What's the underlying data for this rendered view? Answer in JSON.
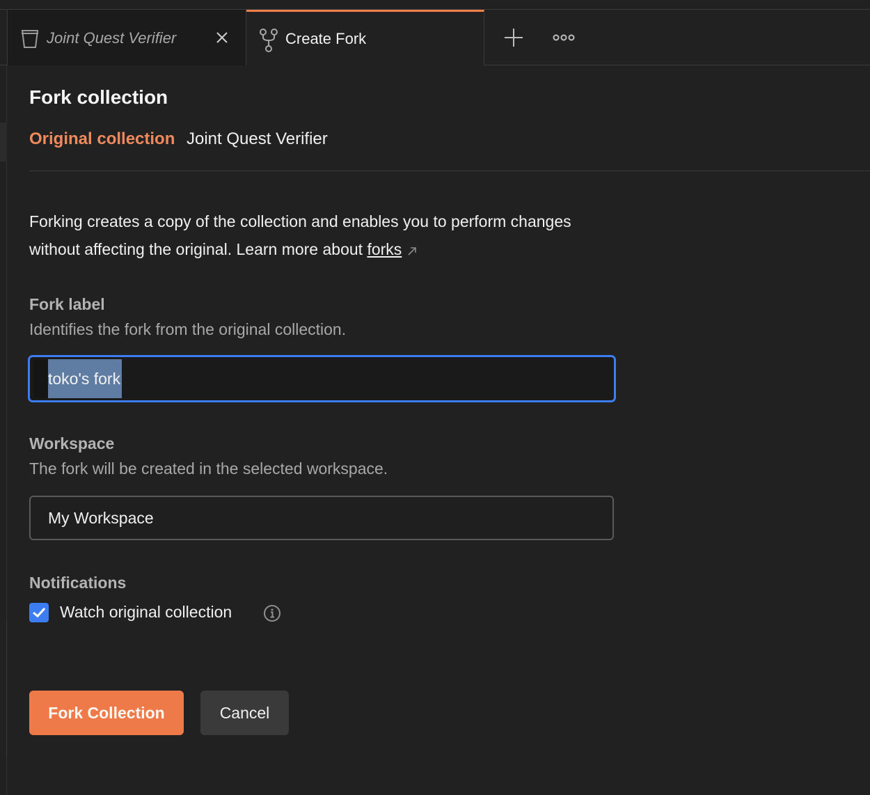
{
  "tabs": [
    {
      "label": "Joint Quest Verifier",
      "icon": "collection-trash-icon",
      "closable": true,
      "italic": true
    },
    {
      "label": "Create Fork",
      "icon": "fork-icon",
      "active": true
    }
  ],
  "tabbar_actions": {
    "new_tab_icon": "plus-icon",
    "more_icon": "more-options-icon"
  },
  "page": {
    "title": "Fork collection",
    "original_label": "Original collection",
    "original_value": "Joint Quest Verifier",
    "description": "Forking creates a copy of the collection and enables you to perform changes without affecting the original. Learn more about ",
    "learn_more_link": "forks"
  },
  "fork_label": {
    "label": "Fork label",
    "help": "Identifies the fork from the original collection.",
    "value": "toko's fork"
  },
  "workspace": {
    "label": "Workspace",
    "help": "The fork will be created in the selected workspace.",
    "value": "My Workspace"
  },
  "notifications": {
    "label": "Notifications",
    "watch_label": "Watch original collection",
    "watch_checked": true
  },
  "buttons": {
    "fork": "Fork Collection",
    "cancel": "Cancel"
  },
  "colors": {
    "accent": "#ef7a49",
    "focus": "#3d7df2",
    "background": "#212121"
  }
}
